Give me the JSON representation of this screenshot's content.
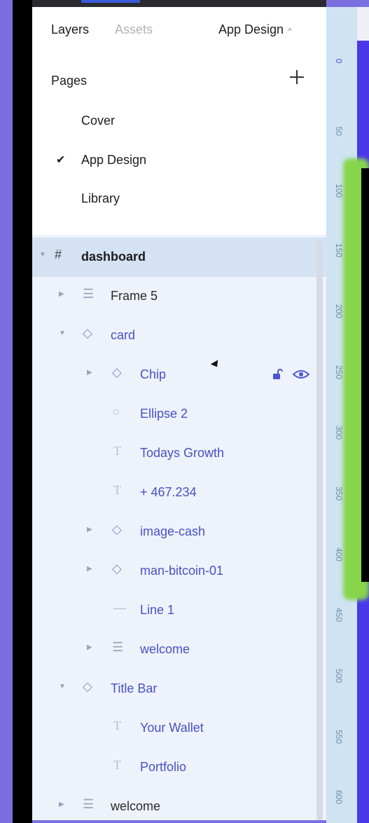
{
  "header": {
    "tabs": [
      {
        "label": "Layers",
        "active": true
      },
      {
        "label": "Assets",
        "active": false
      }
    ],
    "page_selector": "App Design"
  },
  "pages": {
    "title": "Pages",
    "items": [
      {
        "label": "Cover",
        "checked": false
      },
      {
        "label": "App Design",
        "checked": true
      },
      {
        "label": "Library",
        "checked": false
      }
    ]
  },
  "layers": {
    "rows": [
      {
        "label": "dashboard",
        "icon": "frame-hash-icon",
        "expanded": true,
        "selected": true
      },
      {
        "label": "Frame 5",
        "icon": "auto-layout-icon",
        "expanded": false
      },
      {
        "label": "card",
        "icon": "component-icon",
        "expanded": true
      },
      {
        "label": "Chip",
        "icon": "component-icon",
        "expanded": false
      },
      {
        "label": "Ellipse 2",
        "icon": "ellipse-icon"
      },
      {
        "label": "Todays Growth",
        "icon": "text-icon"
      },
      {
        "label": "+ 467.234",
        "icon": "text-icon"
      },
      {
        "label": "image-cash",
        "icon": "component-icon",
        "expanded": false
      },
      {
        "label": "man-bitcoin-01",
        "icon": "component-icon",
        "expanded": false
      },
      {
        "label": "Line 1",
        "icon": "line-icon"
      },
      {
        "label": "welcome",
        "icon": "auto-layout-icon",
        "expanded": false
      },
      {
        "label": "Title Bar",
        "icon": "component-icon",
        "expanded": true
      },
      {
        "label": "Your Wallet",
        "icon": "text-icon"
      },
      {
        "label": "Portfolio",
        "icon": "text-icon"
      },
      {
        "label": "welcome",
        "icon": "auto-layout-icon",
        "expanded": false
      }
    ]
  },
  "ruler": {
    "ticks": [
      "0",
      "50",
      "100",
      "150",
      "200",
      "250",
      "300",
      "350",
      "400",
      "450",
      "500",
      "550",
      "600"
    ]
  },
  "colors": {
    "accent": "#3f52d0",
    "layer_text": "#4752c4",
    "background": "#7b6fe0"
  }
}
